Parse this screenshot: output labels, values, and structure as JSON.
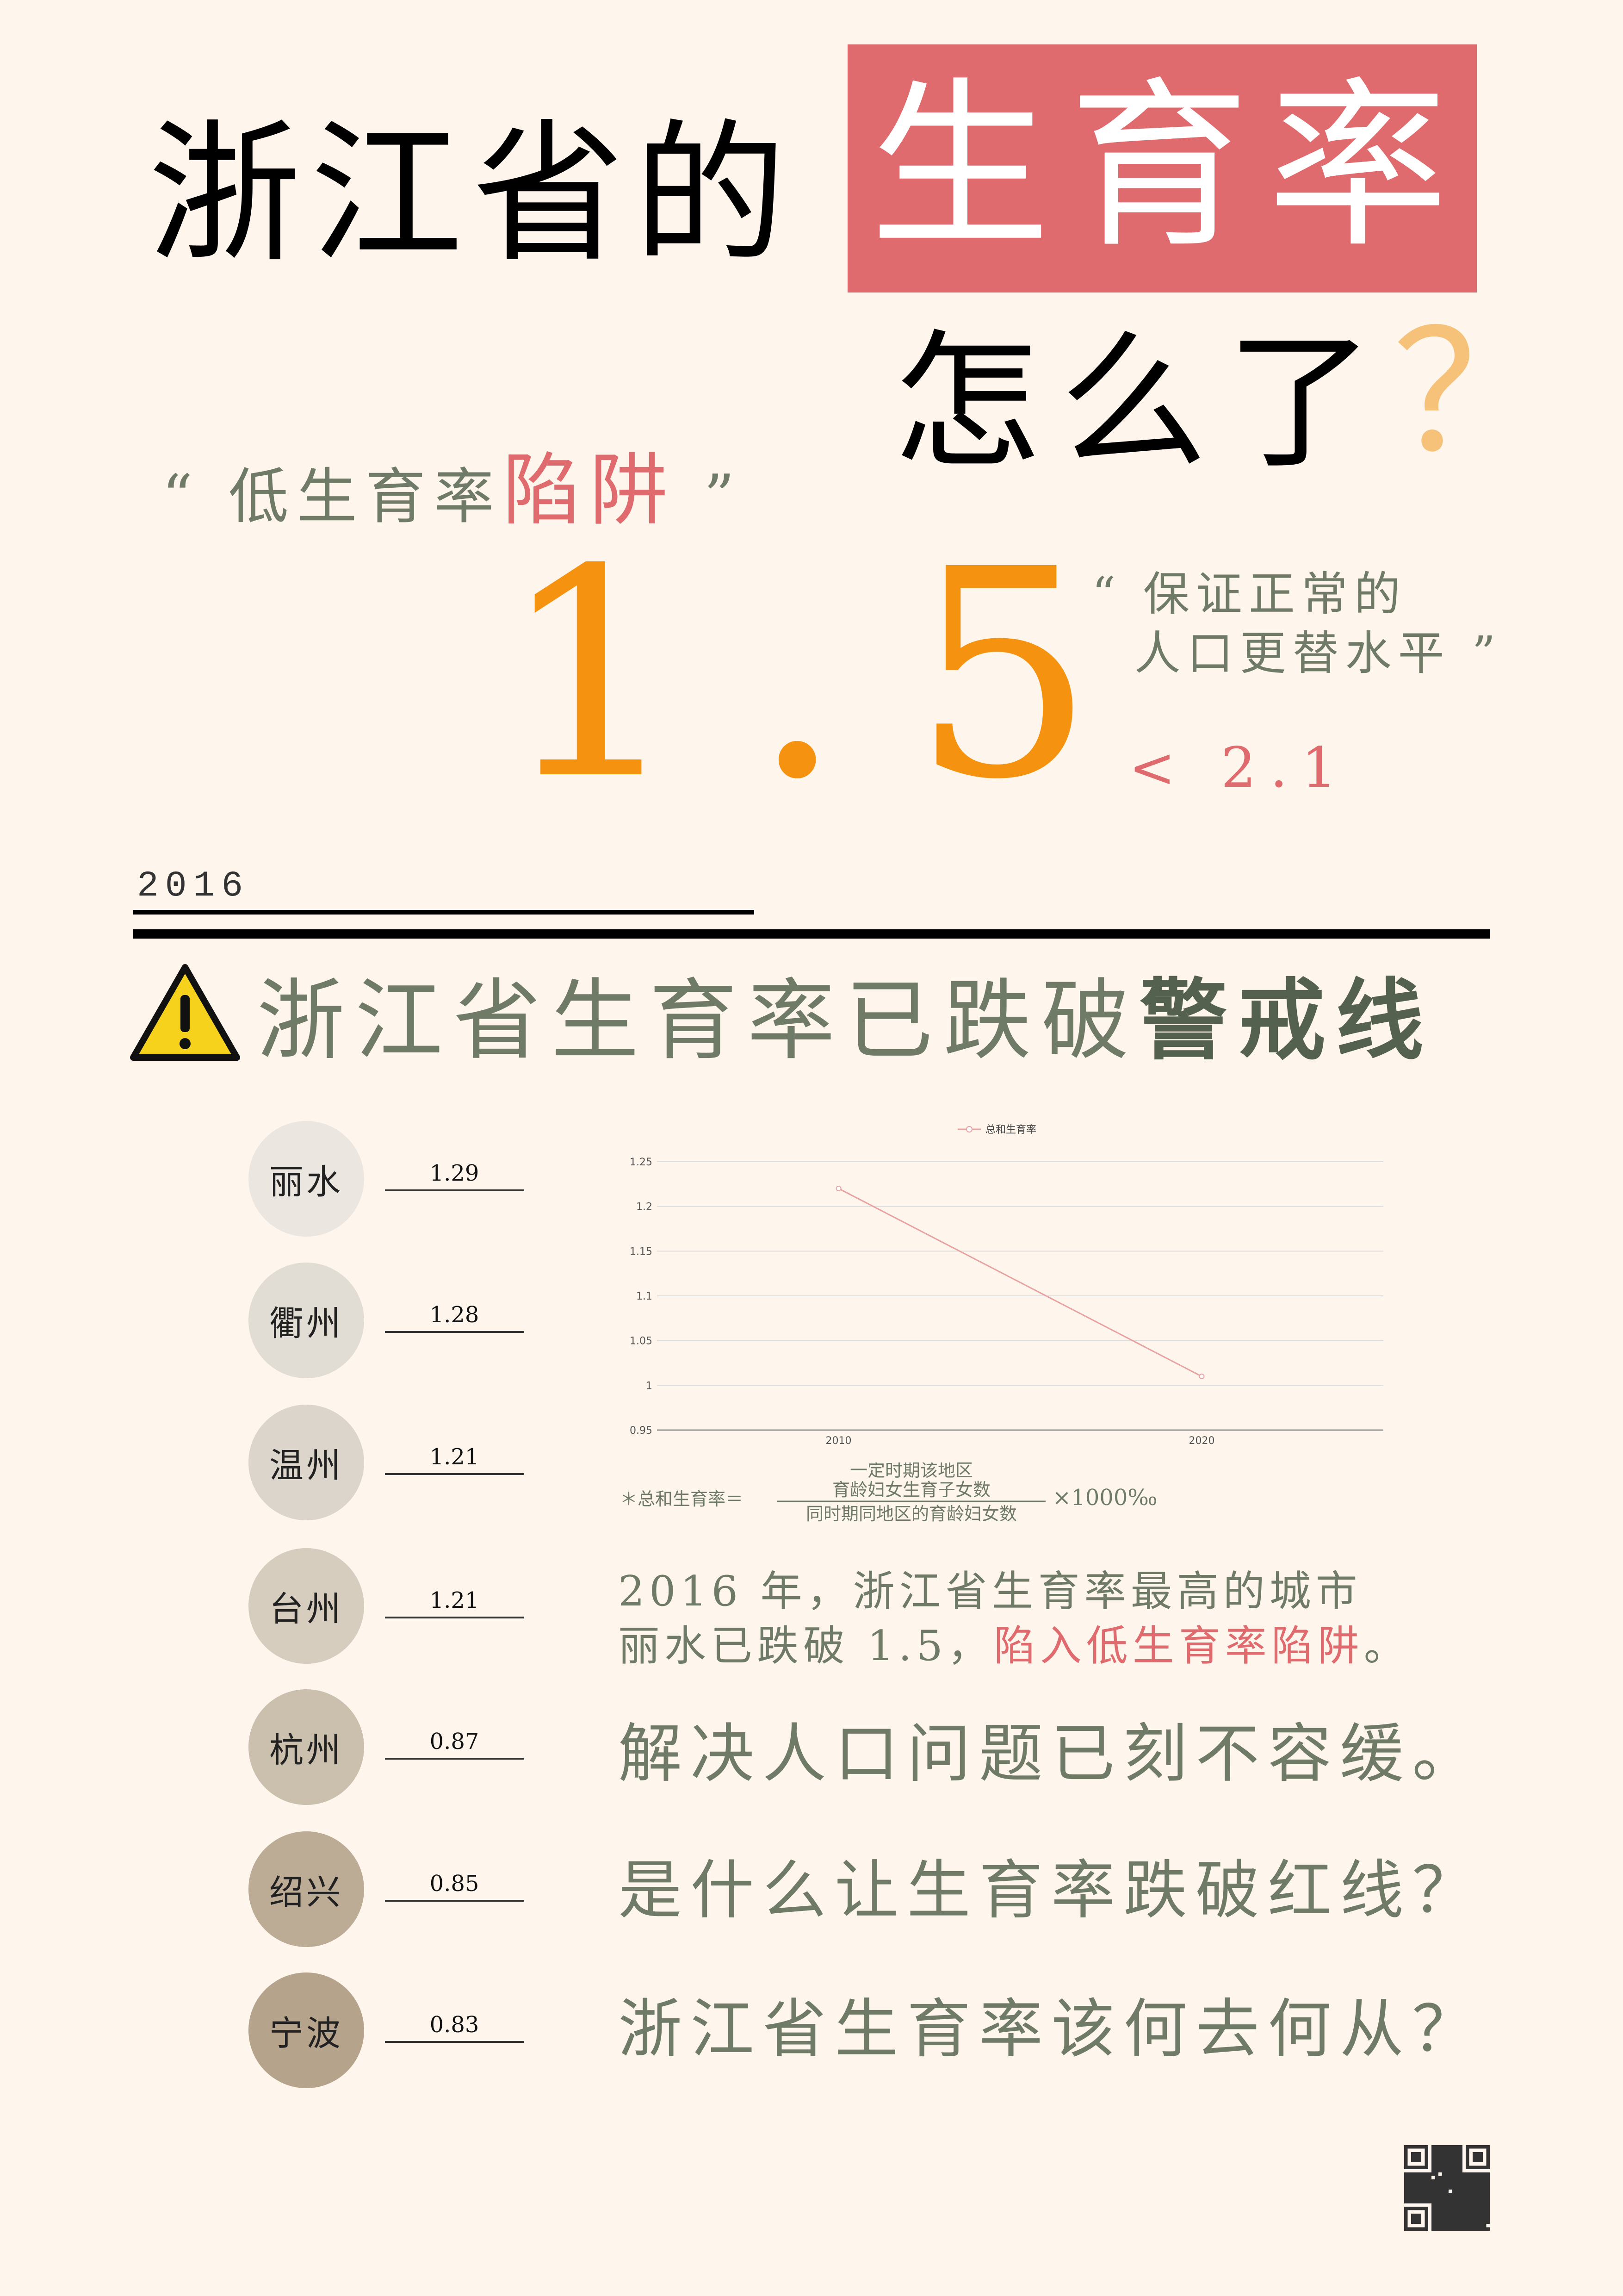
{
  "title": {
    "main": "浙江省的",
    "highlight": "生育率",
    "sub": "怎么了",
    "question_mark": "？"
  },
  "trap": {
    "open_quote": "“",
    "prefix": "低生育率",
    "highlight": "陷阱",
    "close_quote": "”"
  },
  "big_number": "1.5",
  "replacement": {
    "text": "“ 保证正常的\n  人口更替水平 ”",
    "comparison": "< 2.1"
  },
  "year": "2016",
  "warning": {
    "icon": "warning-triangle-icon",
    "prefix": "浙江省生育率已跌破",
    "bold": "警戒线"
  },
  "cities": [
    {
      "name": "丽水",
      "value": "1.29",
      "color": "#ebe6e0"
    },
    {
      "name": "衢州",
      "value": "1.28",
      "color": "#e1ddd4"
    },
    {
      "name": "温州",
      "value": "1.21",
      "color": "#dbd5cb"
    },
    {
      "name": "台州",
      "value": "1.21",
      "color": "#d6cdbf"
    },
    {
      "name": "杭州",
      "value": "0.87",
      "color": "#cbbfae"
    },
    {
      "name": "绍兴",
      "value": "0.85",
      "color": "#bcab95"
    },
    {
      "name": "宁波",
      "value": "0.83",
      "color": "#b5a38b"
    }
  ],
  "chart_data": {
    "type": "line",
    "x": [
      "2010",
      "2020"
    ],
    "series": [
      {
        "name": "总和生育率",
        "values": [
          1.22,
          1.01
        ],
        "color": "#e8a2a2"
      }
    ],
    "ylim": [
      0.95,
      1.25
    ],
    "yticks": [
      "0.95",
      "1",
      "1.05",
      "1.1",
      "1.15",
      "1.2",
      "1.25"
    ],
    "grid": true,
    "legend": "top"
  },
  "formula": {
    "label": "＊总和生育率＝",
    "numerator_top": "一定时期该地区",
    "numerator": "育龄妇女生育子女数",
    "denominator": "同时期同地区的育龄妇女数",
    "multiplier": "×1000‰"
  },
  "paragraph": {
    "line1": "2016 年，浙江省生育率最高的城市",
    "line2_prefix": "丽水已跌破 1.5，",
    "line2_highlight": "陷入低生育率陷阱",
    "line2_suffix": "。"
  },
  "statements": [
    "解决人口问题已刻不容缓。",
    "是什么让生育率跌破红线？",
    "浙江省生育率该何去何从？"
  ],
  "qr": "qr-code-icon"
}
